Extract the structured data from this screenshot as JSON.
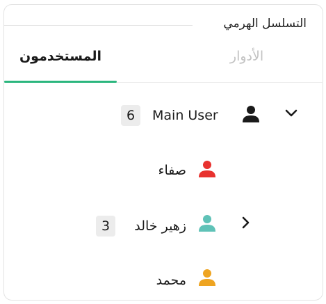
{
  "fieldset": {
    "legend": "التسلسل الهرمي"
  },
  "tabs": [
    {
      "label": "الأدوار",
      "active": false
    },
    {
      "label": "المستخدمون",
      "active": true
    }
  ],
  "accent_color": "#2bb67e",
  "tree": [
    {
      "name": "Main User",
      "count": "6",
      "icon": "user-icon",
      "icon_color": "#1a1a1a",
      "toggle": "chevron-down-icon"
    },
    {
      "name": "صفاء",
      "icon": "user-icon",
      "icon_color": "#e8322f"
    },
    {
      "name": "زهير خالد",
      "count": "3",
      "icon": "user-icon",
      "icon_color": "#5fc2b7",
      "toggle": "chevron-right-icon"
    },
    {
      "name": "محمد",
      "icon": "user-icon",
      "icon_color": "#eea421"
    }
  ]
}
